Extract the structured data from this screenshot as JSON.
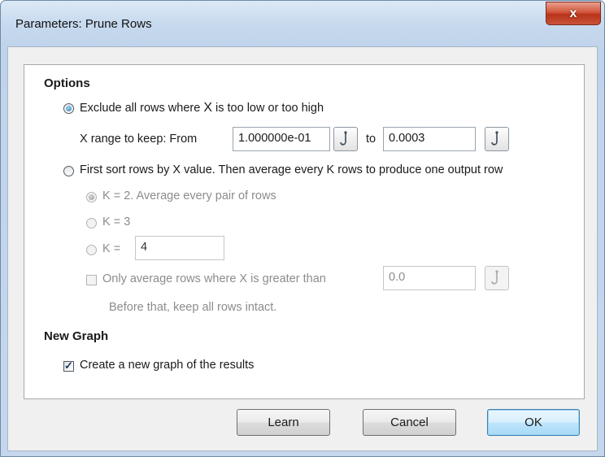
{
  "window": {
    "title": "Parameters: Prune Rows",
    "close_label": "x"
  },
  "options": {
    "heading": "Options",
    "exclude": {
      "label_part1": "Exclude all rows where ",
      "label_x": "X",
      "label_part2": " is too low or too high",
      "selected": true
    },
    "range": {
      "label": "X range to keep:  From",
      "from_value": "1.000000e-01",
      "to_label": "to",
      "to_value": "0.0003"
    },
    "sort": {
      "label": "First sort rows by X value. Then average every K rows to produce one output row",
      "selected": false
    },
    "k2": {
      "label": "K = 2. Average every pair of rows",
      "selected": true
    },
    "k3": {
      "label": "K = 3"
    },
    "kcustom": {
      "label": "K =",
      "value": "4"
    },
    "only_average": {
      "label": "Only average rows where X is greater than",
      "value": "0.0",
      "checked": false
    },
    "note": "Before that, keep all rows intact."
  },
  "new_graph": {
    "heading": "New Graph",
    "create_label": "Create a new graph of the results",
    "checked": true,
    "check_glyph": "✓"
  },
  "buttons": {
    "learn": "Learn",
    "cancel": "Cancel",
    "ok": "OK"
  },
  "icons": {
    "picker": "dropper-hook-icon"
  }
}
